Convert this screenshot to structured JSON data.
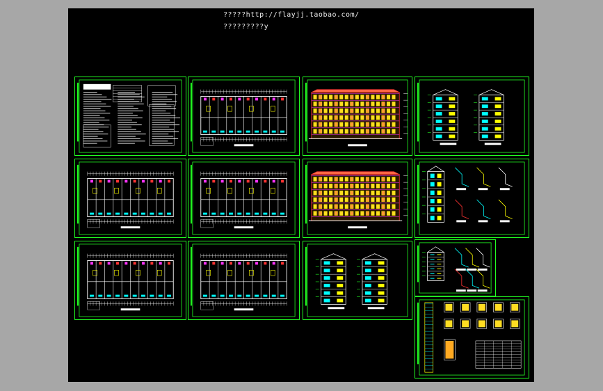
{
  "header": {
    "line1": "?????http://flayjj.taobao.com/",
    "line2": "?????????y"
  },
  "colors": {
    "background": "#a7a7a7",
    "canvas": "#000000",
    "frame": "#22ff22",
    "cyan": "#00ffff",
    "yellow": "#ffff00",
    "red": "#ff3333",
    "magenta": "#ff33ff",
    "white": "#ffffff"
  },
  "sheets": [
    {
      "kind": "notes"
    },
    {
      "kind": "plan"
    },
    {
      "kind": "elevation"
    },
    {
      "kind": "section"
    },
    {
      "kind": "plan"
    },
    {
      "kind": "plan"
    },
    {
      "kind": "elevation"
    },
    {
      "kind": "details"
    },
    {
      "kind": "plan"
    },
    {
      "kind": "plan"
    },
    {
      "kind": "section"
    },
    {
      "kind": "details"
    },
    {
      "kind": "windows"
    }
  ]
}
